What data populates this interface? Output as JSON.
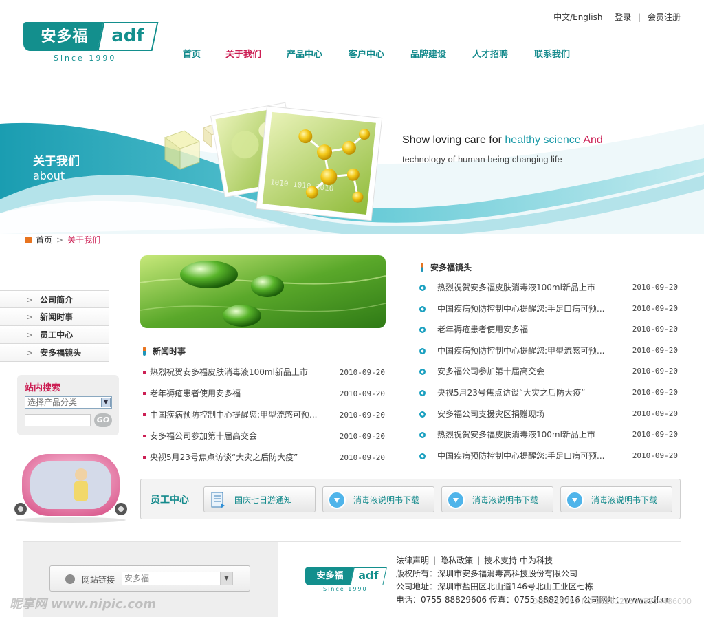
{
  "header": {
    "logo_cn": "安多福",
    "logo_en": "adf",
    "since": "Since 1990",
    "top_links": {
      "language": "中文/English",
      "login": "登录",
      "register": "会员注册"
    },
    "nav": [
      {
        "label": "首页",
        "active": false
      },
      {
        "label": "关于我们",
        "active": true
      },
      {
        "label": "产品中心",
        "active": false
      },
      {
        "label": "客户中心",
        "active": false
      },
      {
        "label": "品牌建设",
        "active": false
      },
      {
        "label": "人才招聘",
        "active": false
      },
      {
        "label": "联系我们",
        "active": false
      }
    ]
  },
  "banner": {
    "title_cn": "关于我们",
    "title_en": "about",
    "slogan_part1": "Show loving care for ",
    "slogan_part2": "healthy science",
    "slogan_part3": " And",
    "slogan_line2": "technology of human being changing life"
  },
  "breadcrumb": {
    "home": "首页",
    "current": "关于我们"
  },
  "sidebar": {
    "items": [
      {
        "label": "公司简介"
      },
      {
        "label": "新闻时事"
      },
      {
        "label": "员工中心"
      },
      {
        "label": "安多福镜头"
      }
    ],
    "search": {
      "title": "站内搜索",
      "category_value": "选择产品分类",
      "go_label": "GO"
    }
  },
  "news": {
    "title": "新闻时事",
    "items": [
      {
        "title": "热烈祝贺安多福皮肤消毒液100ml新品上市",
        "date": "2010-09-20"
      },
      {
        "title": "老年褥疮患者使用安多福",
        "date": "2010-09-20"
      },
      {
        "title": "中国疾病预防控制中心提醒您:甲型流感可预...",
        "date": "2010-09-20"
      },
      {
        "title": "安多福公司参加第十届高交会",
        "date": "2010-09-20"
      },
      {
        "title": "央视5月23号焦点访谈“大灾之后防大疫”",
        "date": "2010-09-20"
      }
    ]
  },
  "lens": {
    "title": "安多福镜头",
    "items": [
      {
        "title": "热烈祝贺安多福皮肤消毒液100ml新品上市",
        "date": "2010-09-20"
      },
      {
        "title": "中国疾病预防控制中心提醒您:手足口病可预...",
        "date": "2010-09-20"
      },
      {
        "title": "老年褥疮患者使用安多福",
        "date": "2010-09-20"
      },
      {
        "title": "中国疾病预防控制中心提醒您:甲型流感可预...",
        "date": "2010-09-20"
      },
      {
        "title": "安多福公司参加第十届高交会",
        "date": "2010-09-20"
      },
      {
        "title": "央视5月23号焦点访谈“大灾之后防大疫”",
        "date": "2010-09-20"
      },
      {
        "title": "安多福公司支援灾区捐赠现场",
        "date": "2010-09-20"
      },
      {
        "title": "热烈祝贺安多福皮肤消毒液100ml新品上市",
        "date": "2010-09-20"
      },
      {
        "title": "中国疾病预防控制中心提醒您:手足口病可预...",
        "date": "2010-09-20"
      }
    ]
  },
  "staff_center": {
    "label": "员工中心",
    "buttons": [
      {
        "label": "国庆七日游通知",
        "icon": "document-icon"
      },
      {
        "label": "消毒液说明书下载",
        "icon": "download-icon"
      },
      {
        "label": "消毒液说明书下载",
        "icon": "download-icon"
      },
      {
        "label": "消毒液说明书下载",
        "icon": "download-icon"
      }
    ]
  },
  "footer": {
    "friend_links_label": "网站链接",
    "friend_links_value": "安多福",
    "logo_cn": "安多福",
    "logo_en": "adf",
    "since": "Since 1990",
    "links": [
      "法律声明",
      "隐私政策",
      "技术支持 中为科技"
    ],
    "copyright": "版权所有：深圳市安多福消毒高科技股份有限公司",
    "address": "公司地址：深圳市盐田区北山道146号北山工业区七栋",
    "contact": "电话：0755-88829606   传真：0755-88829616  公司网址：www.adf.cn"
  },
  "watermark": {
    "left": "昵享网 www.nipic.com",
    "right": "ID:24210090 NO:20161213015204486000"
  },
  "colors": {
    "brand_teal": "#138f8d",
    "accent_red": "#cc1f54",
    "nav_teal": "#148a8c"
  }
}
